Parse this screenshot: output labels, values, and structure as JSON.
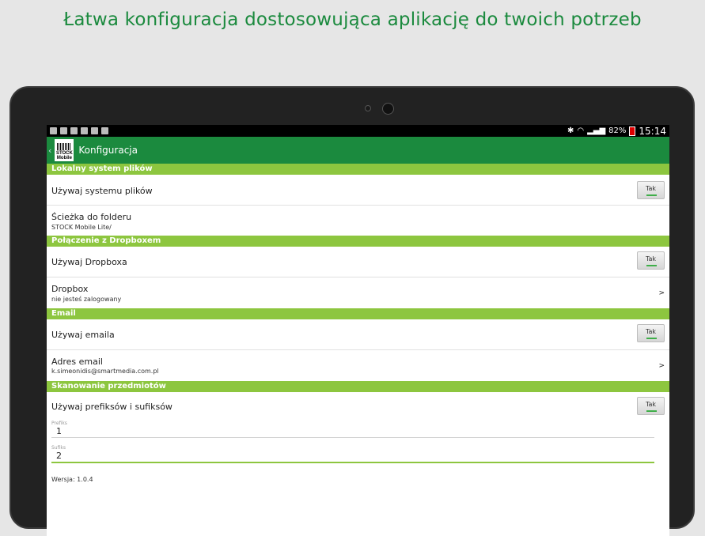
{
  "headline": "Łatwa konfiguracja dostosowująca aplikację do twoich potrzeb",
  "statusbar": {
    "battery": "82%",
    "time": "15:14"
  },
  "actionbar": {
    "title": "Konfiguracja",
    "logo_top": "STOCK",
    "logo_bottom": "Mobile",
    "back": "‹"
  },
  "sections": {
    "local": "Lokalny system plików",
    "dropbox": "Połączenie z Dropboxem",
    "email": "Email",
    "scan": "Skanowanie przedmiotów"
  },
  "local": {
    "use_fs": "Używaj systemu plików",
    "use_fs_toggle": "Tak",
    "folder_label": "Ścieżka do folderu",
    "folder_value": "STOCK Mobile Lite/"
  },
  "dropbox": {
    "use_label": "Używaj Dropboxa",
    "use_toggle": "Tak",
    "account_label": "Dropbox",
    "account_value": "nie jesteś zalogowany",
    "chevron": ">"
  },
  "email": {
    "use_label": "Używaj emaila",
    "use_toggle": "Tak",
    "address_label": "Adres email",
    "address_value": "k.simeonidis@smartmedia.com.pl",
    "chevron": ">"
  },
  "scan": {
    "use_label": "Używaj prefiksów i sufiksów",
    "use_toggle": "Tak",
    "prefix_label": "Prefiks",
    "prefix_value": "1",
    "suffix_label": "Sufiks",
    "suffix_value": "2"
  },
  "version": "Wersja: 1.0.4",
  "colors": {
    "brand": "#1b8a3e",
    "section": "#8dc63f"
  }
}
